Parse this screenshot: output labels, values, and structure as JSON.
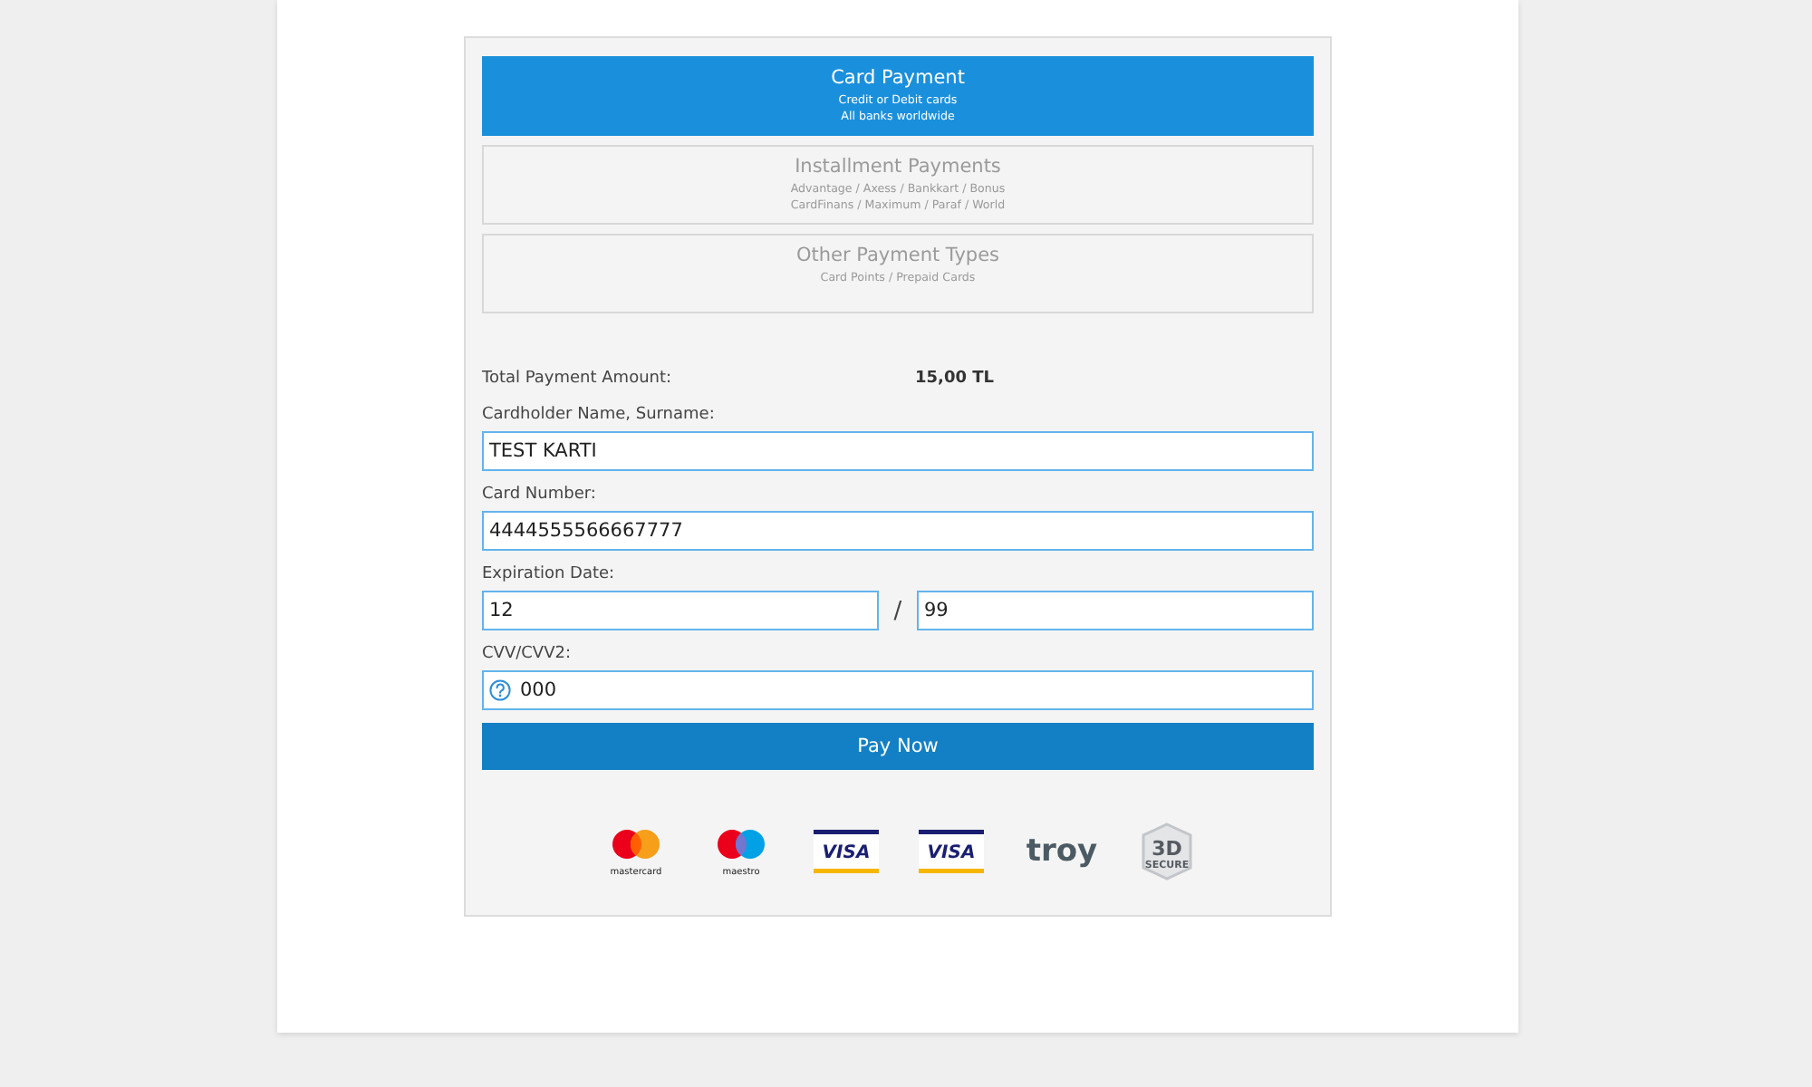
{
  "payment_tabs": [
    {
      "title": "Card Payment",
      "lines": [
        "Credit or Debit cards",
        "All banks worldwide"
      ],
      "selected": true
    },
    {
      "title": "Installment Payments",
      "lines": [
        "Advantage / Axess / Bankkart / Bonus",
        "CardFinans / Maximum / Paraf / World"
      ],
      "selected": false
    },
    {
      "title": "Other Payment Types",
      "lines": [
        "Card Points / Prepaid Cards"
      ],
      "selected": false
    }
  ],
  "form": {
    "total": {
      "label": "Total Payment Amount:",
      "value": "15,00 TL"
    },
    "fields": [
      {
        "kind": "text",
        "label": "Cardholder Name, Surname:",
        "value": "TEST KARTI"
      },
      {
        "kind": "text",
        "label": "Card Number:",
        "value": "4444555566667777"
      },
      {
        "kind": "split",
        "label": "Expiration Date:",
        "values": [
          "12",
          "99"
        ],
        "separator": "/"
      },
      {
        "kind": "help",
        "label": "CVV/CVV2:",
        "value": "000"
      }
    ],
    "submit": "Pay Now"
  },
  "card_logos": [
    {
      "kind": "mastercard",
      "label": "mastercard"
    },
    {
      "kind": "maestro",
      "label": "maestro"
    },
    {
      "kind": "visa",
      "label": "VISA"
    },
    {
      "kind": "visa",
      "label": "VISA"
    },
    {
      "kind": "troy",
      "label": "troy"
    },
    {
      "kind": "secure",
      "label": "3D",
      "sublabel": "SECURE"
    }
  ]
}
